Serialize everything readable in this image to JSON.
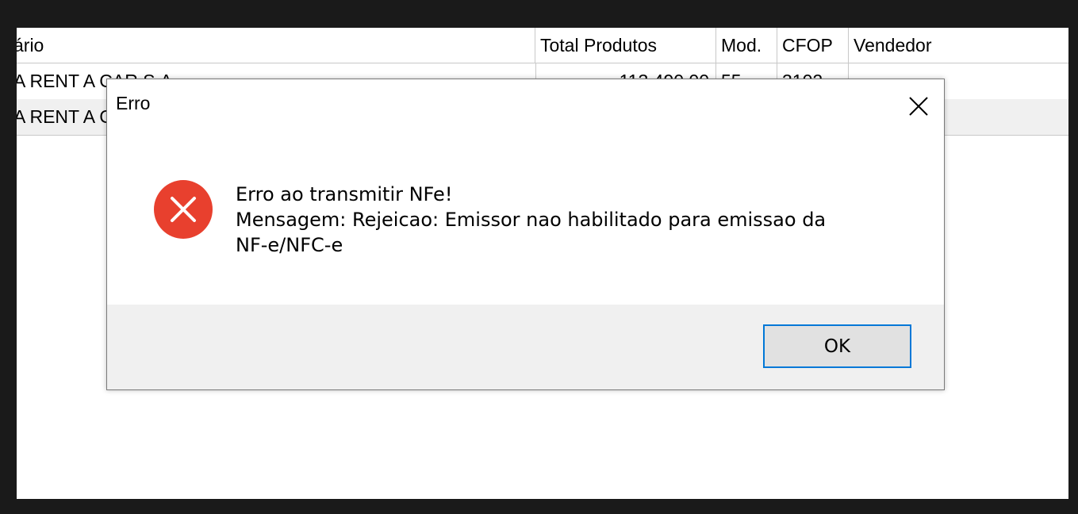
{
  "grid": {
    "columns": {
      "destinatario": "ário",
      "total_produtos": "Total Produtos",
      "mod": "Mod.",
      "cfop": "CFOP",
      "vendedor": "Vendedor"
    },
    "rows": [
      {
        "destinatario": "A RENT A CAR S.A.",
        "total_produtos": "113.490,00",
        "mod": "55",
        "cfop": "3102"
      },
      {
        "destinatario": "A RENT A CAR S.A.",
        "total_produtos": "",
        "mod": "",
        "cfop": ""
      }
    ]
  },
  "dialog": {
    "title": "Erro",
    "close_icon": "close-icon",
    "icon": "error-icon",
    "icon_color": "#e8402e",
    "message_lines": [
      "Erro ao transmitir NFe!",
      "Mensagem: Rejeicao: Emissor nao habilitado para emissao da",
      "NF-e/NFC-e"
    ],
    "ok_label": "OK",
    "accent_color": "#0078d7"
  }
}
